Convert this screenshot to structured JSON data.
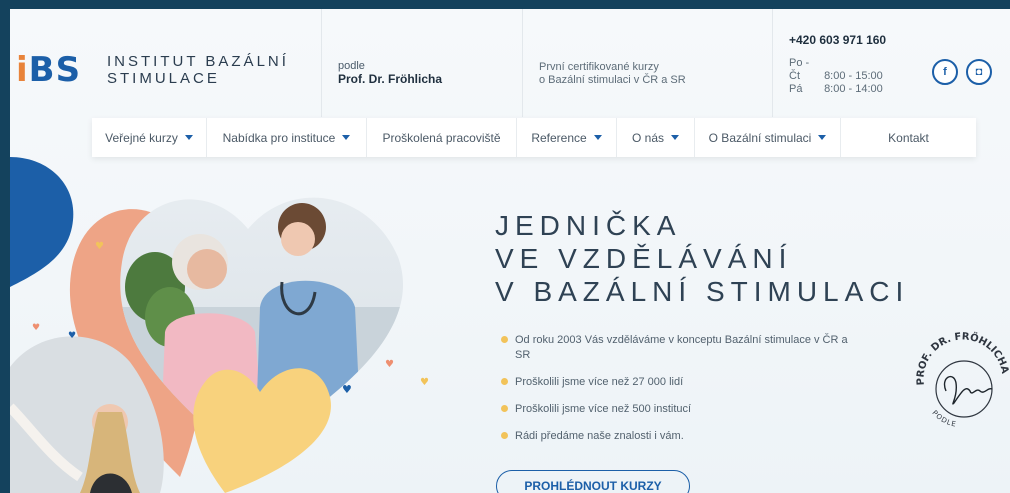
{
  "header": {
    "logo_text": "BS",
    "logo_initial": "i",
    "institute_line1": "INSTITUT BAZÁLNÍ",
    "institute_line2": "STIMULACE",
    "podle_small": "podle",
    "podle_name": "Prof. Dr. Fröhlicha",
    "courses_line1": "První certifikované kurzy",
    "courses_line2": "o Bazální stimulaci v ČR a SR",
    "phone": "+420 603 971 160",
    "hours": [
      {
        "days": "Po - Čt",
        "time": "8:00 - 15:00"
      },
      {
        "days": "Pá",
        "time": "8:00 - 14:00"
      }
    ],
    "social": {
      "facebook": "f",
      "instagram": "◘"
    }
  },
  "nav": [
    {
      "label": "Veřejné kurzy",
      "dropdown": true
    },
    {
      "label": "Nabídka pro instituce",
      "dropdown": true
    },
    {
      "label": "Proškolená pracoviště",
      "dropdown": false
    },
    {
      "label": "Reference",
      "dropdown": true
    },
    {
      "label": "O nás",
      "dropdown": true
    },
    {
      "label": "O Bazální stimulaci",
      "dropdown": true
    },
    {
      "label": "Kontakt",
      "dropdown": false
    }
  ],
  "hero": {
    "heading_line1": "JEDNIČKA",
    "heading_line2": "VE VZDĚLÁVÁNÍ",
    "heading_line3": "V BAZÁLNÍ STIMULACI",
    "bullets": [
      "Od roku 2003 Vás vzděláváme v konceptu Bazální stimulace v ČR a SR",
      "Proškolili jsme více než 27 000 lidí",
      "Proškolili jsme více než 500 institucí",
      "Rádi předáme naše znalosti i vám."
    ],
    "cta_label": "PROHLÉDNOUT KURZY"
  },
  "stamp": {
    "arc_text": "PROF. DR. FRÖHLICHA",
    "bottom_text": "PODLE"
  },
  "colors": {
    "brand_blue": "#1c5fa8",
    "brand_orange": "#e8833a",
    "salmon": "#eea486",
    "yellow": "#f8d27d"
  }
}
